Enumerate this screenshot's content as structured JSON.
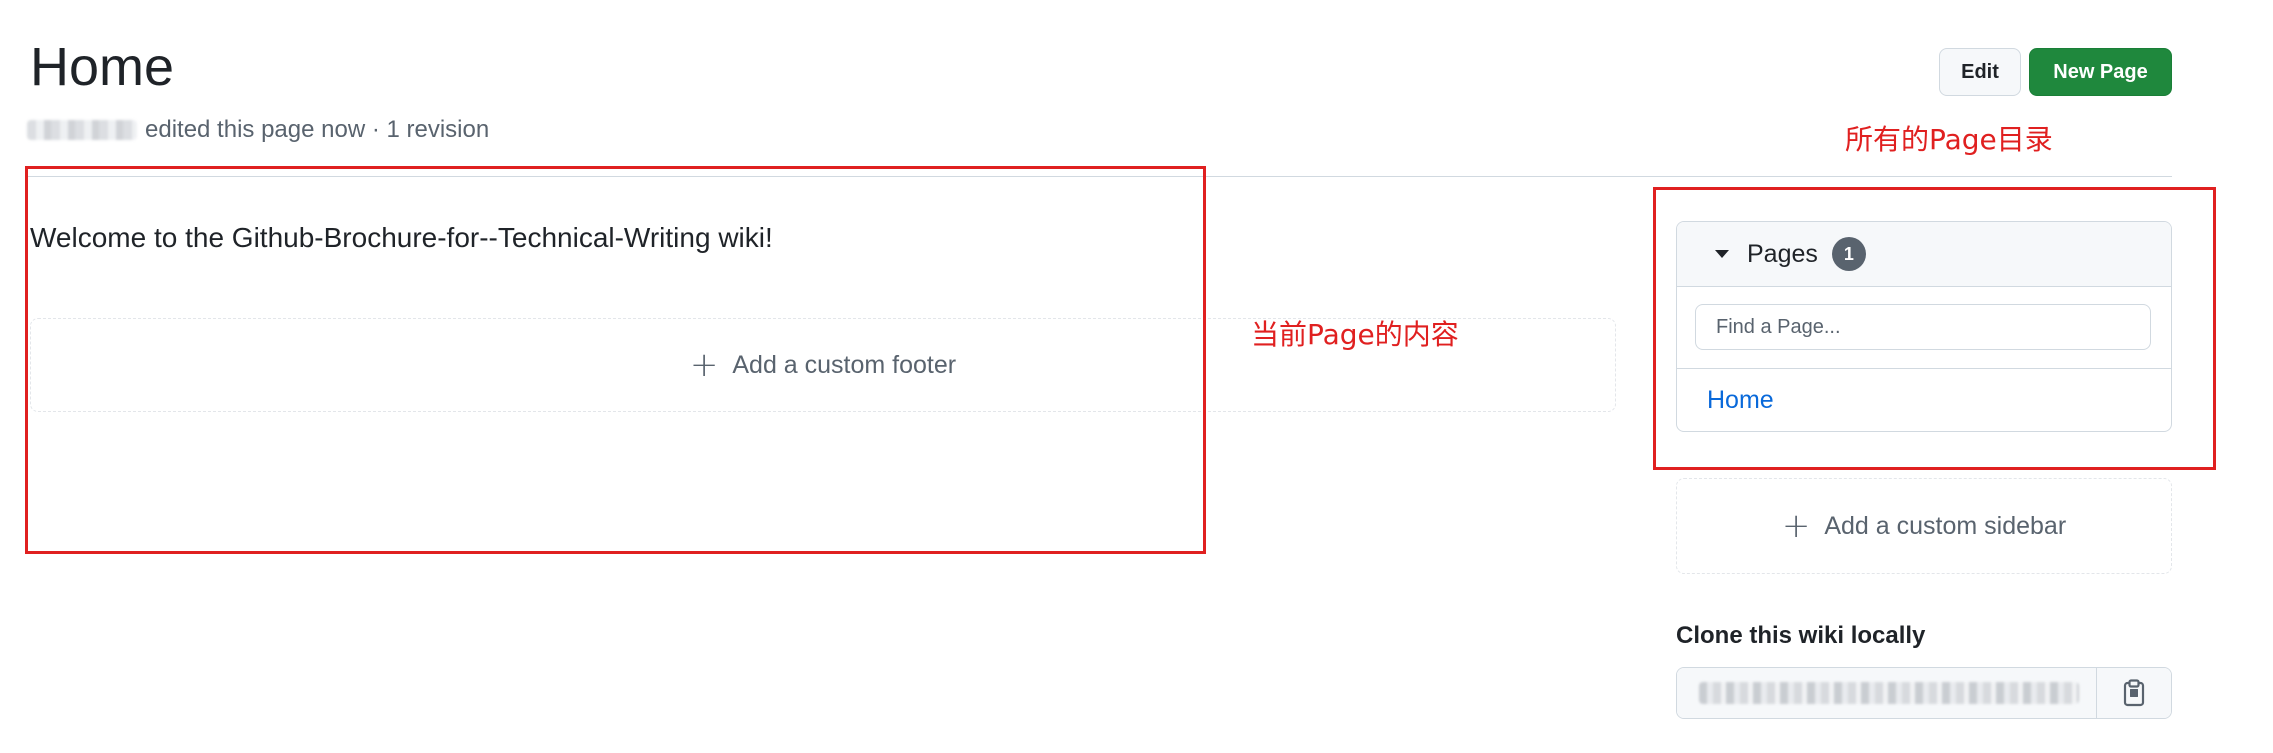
{
  "header": {
    "title": "Home",
    "meta_text": "edited this page now · 1 revision",
    "edit_label": "Edit",
    "new_page_label": "New Page"
  },
  "content": {
    "welcome_text": "Welcome to the Github-Brochure-for--Technical-Writing wiki!",
    "add_footer_label": "Add a custom footer"
  },
  "sidebar": {
    "pages_label": "Pages",
    "pages_count": "1",
    "search_placeholder": "Find a Page...",
    "pages": [
      {
        "label": "Home"
      }
    ],
    "add_sidebar_label": "Add a custom sidebar",
    "clone_title": "Clone this wiki locally"
  },
  "annotations": {
    "main_note": "当前Page的内容",
    "sidebar_note": "所有的Page目录",
    "color": "#e02020"
  },
  "colors": {
    "primary_button": "#1f883d",
    "link": "#0969da",
    "muted_text": "#59636e"
  }
}
